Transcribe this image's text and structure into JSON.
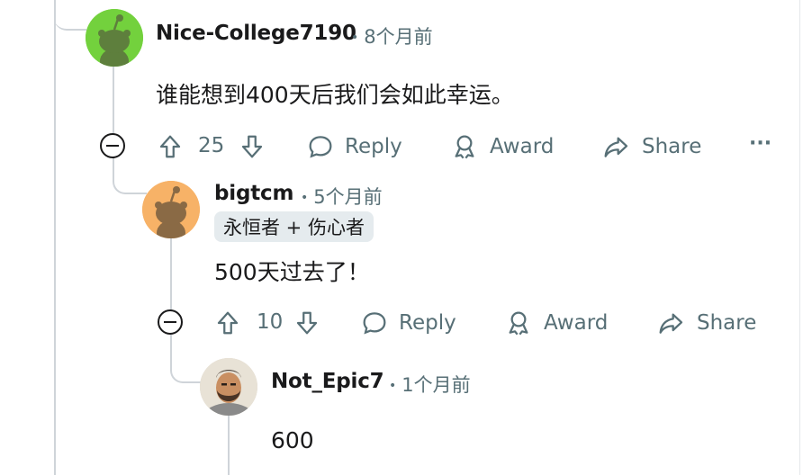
{
  "comments": [
    {
      "username": "Nice-College7190",
      "time": "8个月前",
      "body": "谁能想到400天后我们会如此幸运。",
      "votes": "25",
      "reply_label": "Reply",
      "award_label": "Award",
      "share_label": "Share",
      "more_label": "···",
      "avatar_color": "#73d13d"
    },
    {
      "username": "bigtcm",
      "time": "5个月前",
      "flair": "永恒者 + 伤心者",
      "body": "500天过去了！",
      "votes": "10",
      "reply_label": "Reply",
      "award_label": "Award",
      "share_label": "Share",
      "avatar_color": "#f7b267"
    },
    {
      "username": "Not_Epic7",
      "time": "1个月前",
      "body": "600"
    }
  ],
  "separator_dot": "•",
  "colors": {
    "thread_line": "#cfd4d9",
    "meta": "#576f76",
    "flair_bg": "#e5ebee"
  }
}
